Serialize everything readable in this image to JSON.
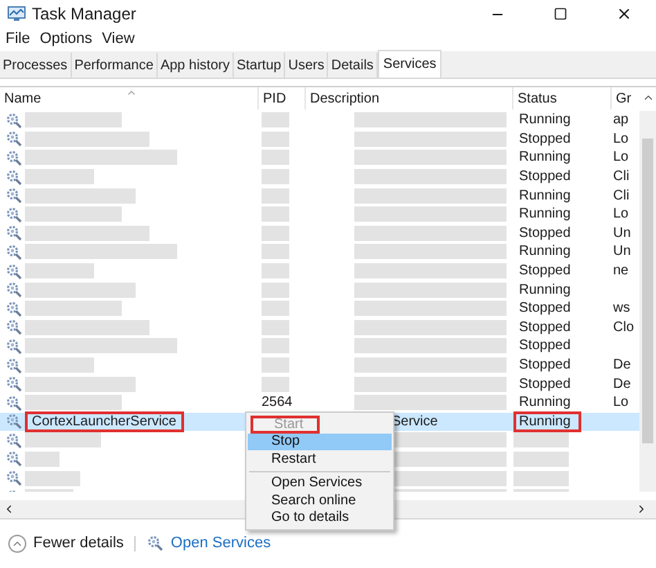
{
  "window": {
    "title": "Task Manager"
  },
  "menu": [
    "File",
    "Options",
    "View"
  ],
  "tabs": [
    {
      "label": "Processes",
      "selected": false
    },
    {
      "label": "Performance",
      "selected": false
    },
    {
      "label": "App history",
      "selected": false
    },
    {
      "label": "Startup",
      "selected": false
    },
    {
      "label": "Users",
      "selected": false
    },
    {
      "label": "Details",
      "selected": false
    },
    {
      "label": "Services",
      "selected": true
    }
  ],
  "table": {
    "columns": [
      "Name",
      "PID",
      "Description",
      "Status",
      "Gr"
    ],
    "rows": [
      {
        "status": "Running",
        "group": "ap",
        "selected": false
      },
      {
        "status": "Stopped",
        "group": "Lo",
        "selected": false
      },
      {
        "status": "Running",
        "group": "Lo",
        "selected": false
      },
      {
        "status": "Stopped",
        "group": "Cli",
        "selected": false
      },
      {
        "status": "Running",
        "group": "Cli",
        "selected": false
      },
      {
        "status": "Running",
        "group": "Lo",
        "selected": false
      },
      {
        "status": "Stopped",
        "group": "Un",
        "selected": false
      },
      {
        "status": "Running",
        "group": "Un",
        "selected": false
      },
      {
        "status": "Stopped",
        "group": "ne",
        "selected": false
      },
      {
        "status": "Running",
        "selected": false
      },
      {
        "status": "Stopped",
        "group": "ws",
        "selected": false
      },
      {
        "status": "Stopped",
        "group": "Clo",
        "selected": false
      },
      {
        "status": "Stopped",
        "selected": false
      },
      {
        "status": "Stopped",
        "group": "De",
        "selected": false
      },
      {
        "status": "Stopped",
        "group": "De",
        "selected": false
      },
      {
        "pid": "2564",
        "status": "Running",
        "group": "Lo",
        "selected": false
      },
      {
        "name": "CortexLauncherService",
        "description": "Service",
        "status": "Running",
        "selected": true,
        "highlighted": true
      },
      {
        "selected": false
      },
      {
        "selected": false
      },
      {
        "selected": false
      },
      {
        "selected": false
      }
    ]
  },
  "context_menu": [
    {
      "label": "Start",
      "disabled": true,
      "selected": false,
      "highlighted": true
    },
    {
      "label": "Stop",
      "disabled": false,
      "selected": true,
      "highlighted": false
    },
    {
      "label": "Restart",
      "disabled": false,
      "selected": false,
      "highlighted": false,
      "separator_after": true
    },
    {
      "label": "Open Services",
      "disabled": false,
      "selected": false,
      "highlighted": false
    },
    {
      "label": "Search online",
      "disabled": false,
      "selected": false,
      "highlighted": false
    },
    {
      "label": "Go to details",
      "disabled": false,
      "selected": false,
      "highlighted": false
    }
  ],
  "footer": {
    "fewer_details": "Fewer details",
    "open_services": "Open Services"
  }
}
